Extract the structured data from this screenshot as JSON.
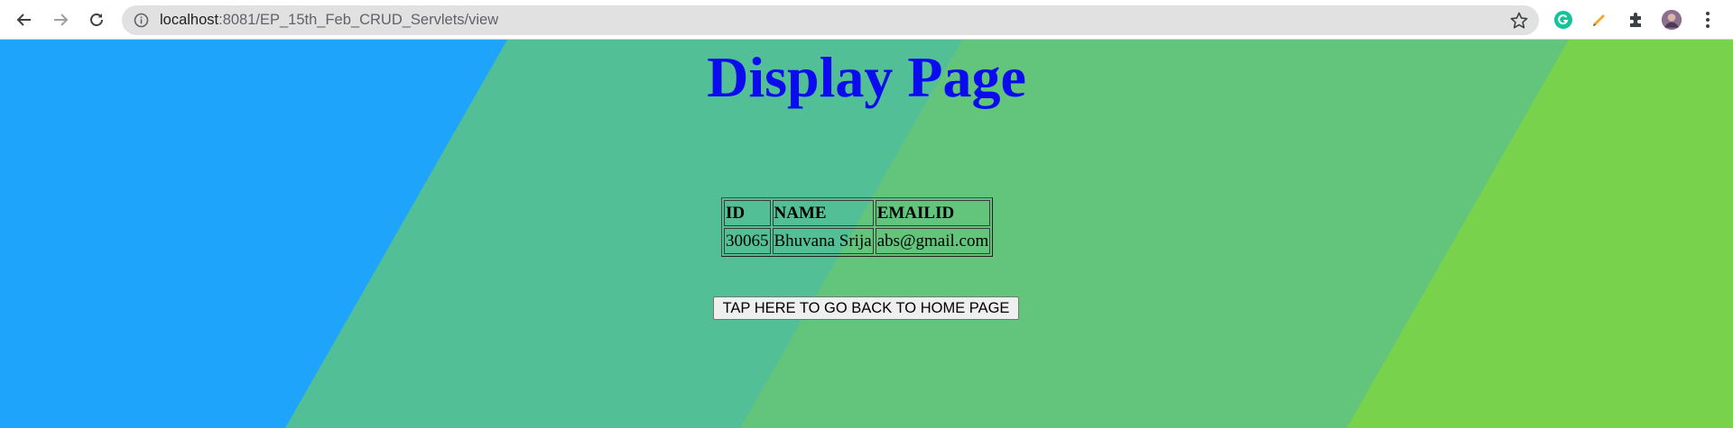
{
  "browser": {
    "url_host": "localhost",
    "url_path": ":8081/EP_15th_Feb_CRUD_Servlets/view",
    "icons": [
      "back-arrow-icon",
      "forward-arrow-icon",
      "reload-icon",
      "info-icon",
      "star-icon",
      "grammarly-icon",
      "pencil-icon",
      "extensions-puzzle-icon",
      "profile-avatar",
      "kebab-menu-icon"
    ]
  },
  "page": {
    "heading": "Display Page",
    "heading_color": "#0b0bf0",
    "background_colors": [
      "#1ea4fb",
      "#52bf96",
      "#62c57b",
      "#78d24c"
    ],
    "table": {
      "headers": [
        "ID",
        "NAME",
        "EMAILID"
      ],
      "rows": [
        [
          "30065",
          "Bhuvana Srija",
          "abs@gmail.com"
        ]
      ]
    },
    "back_button_label": "TAP HERE TO GO BACK TO HOME PAGE"
  }
}
